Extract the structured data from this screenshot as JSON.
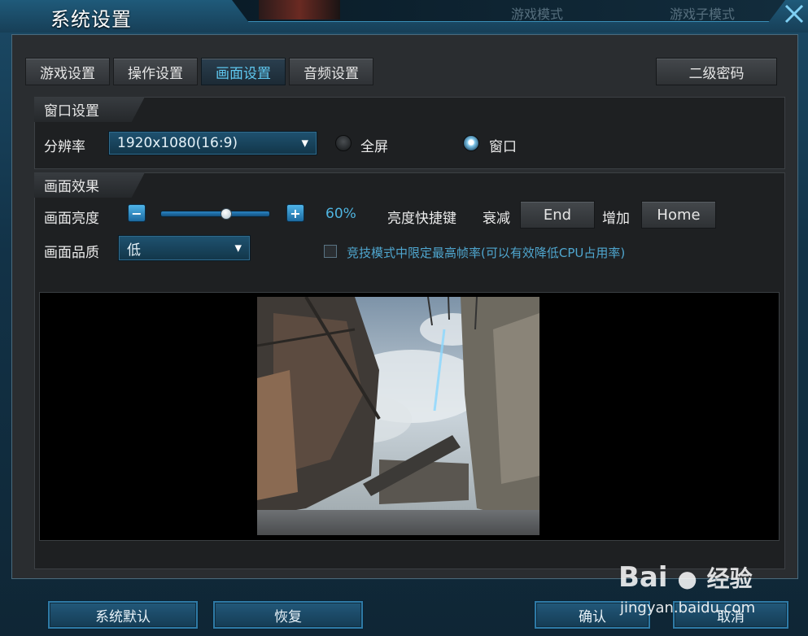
{
  "window": {
    "title": "系统设置",
    "mode_label": "游戏模式",
    "submode_label": "游戏子模式"
  },
  "tabs": [
    {
      "label": "游戏设置",
      "active": false
    },
    {
      "label": "操作设置",
      "active": false
    },
    {
      "label": "画面设置",
      "active": true
    },
    {
      "label": "音频设置",
      "active": false
    }
  ],
  "secondary_password_label": "二级密码",
  "window_settings": {
    "header": "窗口设置",
    "resolution_label": "分辨率",
    "resolution_value": "1920x1080(16:9)",
    "fullscreen_label": "全屏",
    "windowed_label": "窗口",
    "selected_mode": "窗口"
  },
  "display_effects": {
    "header": "画面效果",
    "brightness_label": "画面亮度",
    "brightness_value": "60%",
    "brightness_fraction": 0.6,
    "hotkey_label": "亮度快捷键",
    "decrease_label": "衰减",
    "decrease_key": "End",
    "increase_label": "增加",
    "increase_key": "Home",
    "quality_label": "画面品质",
    "quality_value": "低",
    "fps_limit_label": "竞技模式中限定最高帧率(可以有效降低CPU占用率)",
    "fps_limit_checked": false
  },
  "footer": {
    "default_label": "系统默认",
    "restore_label": "恢复",
    "confirm_label": "确认",
    "cancel_label": "取消"
  },
  "watermark": {
    "brand": "Bai",
    "brand_tail": "经验",
    "url": "jingyan.baidu.com"
  },
  "colors": {
    "accent": "#5fc8f0",
    "frame": "#1b4a66",
    "panel": "#2a2d30"
  }
}
